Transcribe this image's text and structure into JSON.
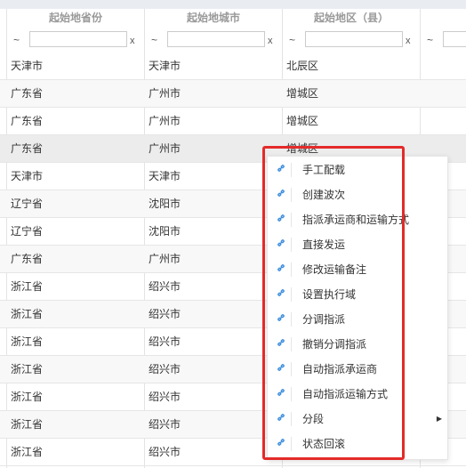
{
  "headers": [
    "起始地省份",
    "起始地城市",
    "起始地区（县）"
  ],
  "filter": {
    "tilde": "~",
    "clear": "x"
  },
  "rows": [
    {
      "province": "天津市",
      "city": "天津市",
      "district": "北辰区"
    },
    {
      "province": "广东省",
      "city": "广州市",
      "district": "增城区"
    },
    {
      "province": "广东省",
      "city": "广州市",
      "district": "增城区"
    },
    {
      "province": "广东省",
      "city": "广州市",
      "district": "增城区"
    },
    {
      "province": "天津市",
      "city": "天津市",
      "district": ""
    },
    {
      "province": "辽宁省",
      "city": "沈阳市",
      "district": ""
    },
    {
      "province": "辽宁省",
      "city": "沈阳市",
      "district": ""
    },
    {
      "province": "广东省",
      "city": "广州市",
      "district": ""
    },
    {
      "province": "浙江省",
      "city": "绍兴市",
      "district": ""
    },
    {
      "province": "浙江省",
      "city": "绍兴市",
      "district": ""
    },
    {
      "province": "浙江省",
      "city": "绍兴市",
      "district": ""
    },
    {
      "province": "浙江省",
      "city": "绍兴市",
      "district": ""
    },
    {
      "province": "浙江省",
      "city": "绍兴市",
      "district": ""
    },
    {
      "province": "浙江省",
      "city": "绍兴市",
      "district": ""
    },
    {
      "province": "浙江省",
      "city": "绍兴市",
      "district": ""
    }
  ],
  "context_menu": {
    "items": [
      {
        "label": "手工配载",
        "icon": "link-icon"
      },
      {
        "label": "创建波次",
        "icon": "link-icon"
      },
      {
        "label": "指派承运商和运输方式",
        "icon": "link-icon"
      },
      {
        "label": "直接发运",
        "icon": "link-icon"
      },
      {
        "label": "修改运输备注",
        "icon": "link-icon"
      },
      {
        "label": "设置执行域",
        "icon": "link-icon"
      },
      {
        "label": "分调指派",
        "icon": "link-icon"
      },
      {
        "label": "撤销分调指派",
        "icon": "link-icon"
      },
      {
        "label": "自动指派承运商",
        "icon": "link-icon"
      },
      {
        "label": "自动指派运输方式",
        "icon": "link-icon"
      },
      {
        "label": "分段",
        "icon": "link-icon",
        "submenu": true
      },
      {
        "label": "状态回滚",
        "icon": "link-icon"
      }
    ]
  },
  "colors": {
    "highlight": "#e42a2a",
    "link_icon": "#3c8dde"
  }
}
